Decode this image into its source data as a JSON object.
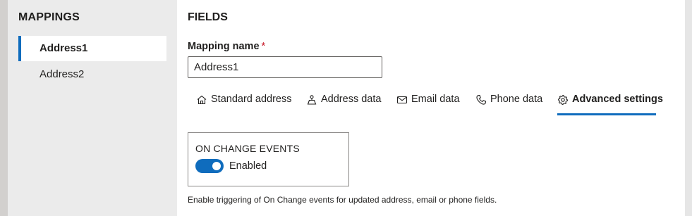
{
  "sidebar": {
    "title": "MAPPINGS",
    "items": [
      {
        "label": "Address1",
        "active": true
      },
      {
        "label": "Address2",
        "active": false
      }
    ]
  },
  "main": {
    "title": "FIELDS",
    "mapping_name": {
      "label": "Mapping name",
      "required_mark": "*",
      "value": "Address1"
    },
    "tabs": [
      {
        "label": "Standard address",
        "icon": "home-icon",
        "active": false
      },
      {
        "label": "Address data",
        "icon": "person-pin-icon",
        "active": false
      },
      {
        "label": "Email data",
        "icon": "mail-icon",
        "active": false
      },
      {
        "label": "Phone data",
        "icon": "phone-icon",
        "active": false
      },
      {
        "label": "Advanced settings",
        "icon": "gear-icon",
        "active": true
      }
    ],
    "on_change_events": {
      "title": "ON CHANGE EVENTS",
      "toggle_label": "Enabled",
      "enabled": true
    },
    "help_text": "Enable triggering of On Change events for updated address, email or phone fields."
  },
  "colors": {
    "accent": "#0f6cbd",
    "required": "#c50f1f",
    "sidebar_bg": "#ebebeb"
  }
}
